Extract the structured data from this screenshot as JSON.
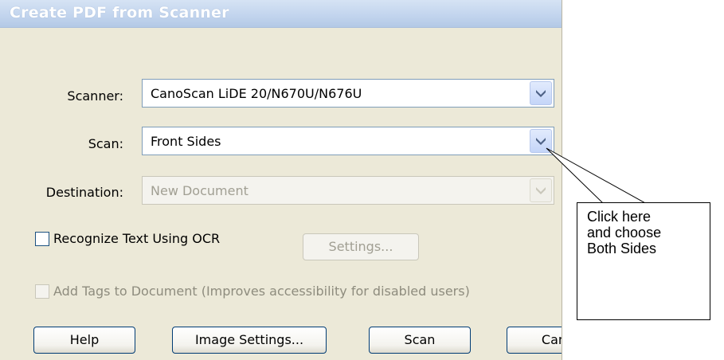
{
  "window": {
    "title": "Create PDF from Scanner"
  },
  "scanner": {
    "label": "Scanner:",
    "value": "CanoScan LiDE 20/N670U/N676U"
  },
  "scan": {
    "label": "Scan:",
    "value": "Front Sides"
  },
  "destination": {
    "label": "Destination:",
    "value": "New Document"
  },
  "ocr": {
    "label": "Recognize Text Using OCR",
    "checked": false,
    "settings_label": "Settings..."
  },
  "tags": {
    "label": "Add Tags to Document (Improves accessibility for disabled users)",
    "checked": false
  },
  "buttons": {
    "help": "Help",
    "image_settings": "Image Settings...",
    "scan": "Scan",
    "cancel": "Cancel"
  },
  "callout": {
    "lines": [
      "Click here",
      "and choose",
      "Both Sides"
    ]
  },
  "icons": {
    "dropdown": "chevron-down-icon"
  },
  "colors": {
    "dialog_bg": "#ece9d8",
    "arrow_blue": "#4d6185",
    "button_border": "#003c74"
  }
}
